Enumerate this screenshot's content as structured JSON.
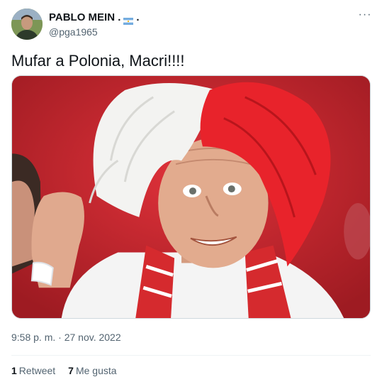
{
  "author": {
    "display_name": "PABLO MEIN .",
    "name_suffix": ".",
    "flag_icon": "argentina-flag-icon",
    "handle": "@pga1965"
  },
  "more_icon": "more-horizontal-icon",
  "tweet": {
    "text": "Mufar a Polonia, Macri!!!!",
    "timestamp": "9:58 p. m. · 27 nov. 2022"
  },
  "stats": {
    "retweets_count": "1",
    "retweets_label": "Retweet",
    "likes_count": "7",
    "likes_label": "Me gusta"
  },
  "colors": {
    "text_primary": "#0f1419",
    "text_secondary": "#536471",
    "border": "#cfd9de"
  }
}
